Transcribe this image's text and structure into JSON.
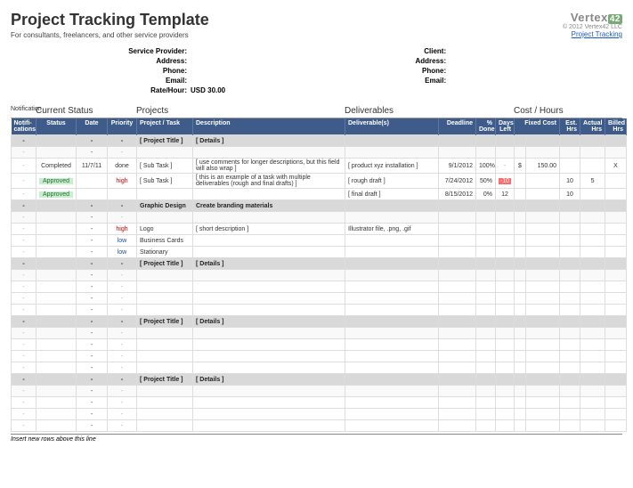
{
  "header": {
    "title": "Project Tracking Template",
    "subtitle": "For consultants, freelancers, and other service providers",
    "logo_text": "Vertex",
    "logo_num": "42",
    "copyright": "© 2012 Vertex42 LLC",
    "link": "Project Tracking"
  },
  "provider": {
    "label_sp": "Service Provider:",
    "label_addr": "Address:",
    "label_phone": "Phone:",
    "label_email": "Email:",
    "label_rate": "Rate/Hour:",
    "rate": "USD 30.00"
  },
  "client": {
    "label_client": "Client:",
    "label_addr": "Address:",
    "label_phone": "Phone:",
    "label_email": "Email:"
  },
  "sections": {
    "notif": "Notification",
    "status": "Current Status",
    "projects": "Projects",
    "deliv": "Deliverables",
    "cost": "Cost / Hours"
  },
  "cols": {
    "notif": "Notifi-cations",
    "status": "Status",
    "date": "Date",
    "prio": "Priority",
    "task": "Project / Task",
    "desc": "Description",
    "deliv": "Deliverable(s)",
    "dead": "Deadline",
    "done": "% Done",
    "days": "Days Left",
    "fixed": "Fixed Cost",
    "est": "Est. Hrs",
    "act": "Actual Hrs",
    "bill": "Billed Hrs"
  },
  "rows": [
    {
      "type": "section",
      "notif": "-",
      "date": "-",
      "prio": "-",
      "task": "[ Project Title ]",
      "desc": "[ Details ]"
    },
    {
      "type": "blank",
      "notif": "-",
      "date": "-",
      "prio": "-"
    },
    {
      "type": "data",
      "notif": "-",
      "status": "Completed",
      "date": "11/7/11",
      "prio": "done",
      "task": "[ Sub Task ]",
      "desc": "[ use comments for longer descriptions, but this field will also wrap ]",
      "deliv": "[ product xyz installation ]",
      "dead": "9/1/2012",
      "done": "100%",
      "days": "-",
      "fc1": "$",
      "fc2": "150.00",
      "bill": "X"
    },
    {
      "type": "data",
      "notif": "-",
      "status": "Approved",
      "status_cls": "approved",
      "prio": "high",
      "prio_cls": "prio-high",
      "task": "[ Sub Task ]",
      "desc": "[ this is an example of a task with multiple deliverables (rough and final drafts) ]",
      "deliv": "[ rough draft ]",
      "dead": "7/24/2012",
      "done": "50%",
      "days": "-10",
      "days_cls": "days-neg",
      "est": "10",
      "act": "5"
    },
    {
      "type": "data",
      "notif": "-",
      "status": "Approved",
      "status_cls": "approved",
      "deliv": "[ final draft ]",
      "dead": "8/15/2012",
      "done": "0%",
      "days": "12",
      "est": "10"
    },
    {
      "type": "section",
      "notif": "-",
      "date": "-",
      "prio": "-",
      "task": "Graphic Design",
      "desc": "Create branding materials"
    },
    {
      "type": "blank",
      "notif": "-",
      "date": "-",
      "prio": "-"
    },
    {
      "type": "data",
      "notif": "-",
      "date": "-",
      "prio": "high",
      "prio_cls": "prio-high",
      "task": "Logo",
      "desc": "[ short description ]",
      "deliv": "Illustrator file, .png, .gif"
    },
    {
      "type": "data",
      "notif": "-",
      "date": "-",
      "prio": "low",
      "prio_cls": "prio-low",
      "task": "Business Cards"
    },
    {
      "type": "data",
      "notif": "-",
      "date": "-",
      "prio": "low",
      "prio_cls": "prio-low",
      "task": "Stationary"
    },
    {
      "type": "section",
      "notif": "-",
      "date": "-",
      "prio": "-",
      "task": "[ Project Title ]",
      "desc": "[ Details ]"
    },
    {
      "type": "blank",
      "notif": "-",
      "date": "-",
      "prio": "-"
    },
    {
      "type": "data",
      "notif": "-",
      "date": "-",
      "prio": "-"
    },
    {
      "type": "data",
      "notif": "-",
      "date": "-",
      "prio": "-"
    },
    {
      "type": "data",
      "notif": "-",
      "date": "-",
      "prio": "-"
    },
    {
      "type": "section",
      "notif": "-",
      "date": "-",
      "prio": "-",
      "task": "[ Project Title ]",
      "desc": "[ Details ]"
    },
    {
      "type": "blank",
      "notif": "-",
      "date": "-",
      "prio": "-"
    },
    {
      "type": "data",
      "notif": "-",
      "date": "-",
      "prio": "-"
    },
    {
      "type": "data",
      "notif": "-",
      "date": "-",
      "prio": "-"
    },
    {
      "type": "data",
      "notif": "-",
      "date": "-",
      "prio": "-"
    },
    {
      "type": "section",
      "notif": "-",
      "date": "-",
      "prio": "-",
      "task": "[ Project Title ]",
      "desc": "[ Details ]"
    },
    {
      "type": "blank",
      "notif": "-",
      "date": "-",
      "prio": "-"
    },
    {
      "type": "data",
      "notif": "-",
      "date": "-",
      "prio": "-"
    },
    {
      "type": "data",
      "notif": "-",
      "date": "-",
      "prio": "-"
    },
    {
      "type": "data",
      "notif": "-",
      "date": "-",
      "prio": "-"
    }
  ],
  "footer": "Insert new rows above this line"
}
